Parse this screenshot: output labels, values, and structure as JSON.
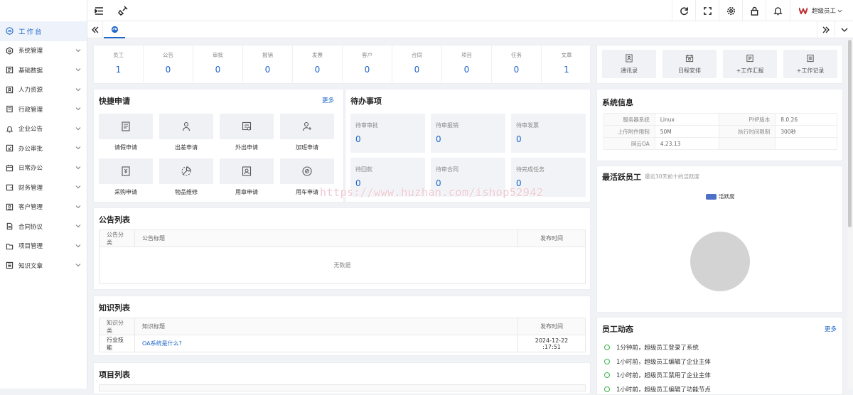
{
  "sidebar": {
    "items": [
      {
        "label": "工作台",
        "icon": "dashboard-icon"
      },
      {
        "label": "系统管理",
        "icon": "system-icon"
      },
      {
        "label": "基础数据",
        "icon": "database-icon"
      },
      {
        "label": "人力资源",
        "icon": "person-card-icon"
      },
      {
        "label": "行政管理",
        "icon": "admin-icon"
      },
      {
        "label": "企业公告",
        "icon": "bell-icon"
      },
      {
        "label": "办公审批",
        "icon": "approval-icon"
      },
      {
        "label": "日常办公",
        "icon": "calendar-icon"
      },
      {
        "label": "财务管理",
        "icon": "wallet-icon"
      },
      {
        "label": "客户管理",
        "icon": "customer-icon"
      },
      {
        "label": "合同协议",
        "icon": "contract-icon"
      },
      {
        "label": "项目管理",
        "icon": "folder-icon"
      },
      {
        "label": "知识文章",
        "icon": "article-icon"
      }
    ]
  },
  "topbar": {
    "user": "超级员工"
  },
  "stats": [
    {
      "label": "员工",
      "value": "1"
    },
    {
      "label": "公告",
      "value": "0"
    },
    {
      "label": "审批",
      "value": "0"
    },
    {
      "label": "报销",
      "value": "0"
    },
    {
      "label": "发票",
      "value": "0"
    },
    {
      "label": "客户",
      "value": "0"
    },
    {
      "label": "合同",
      "value": "0"
    },
    {
      "label": "项目",
      "value": "0"
    },
    {
      "label": "任务",
      "value": "0"
    },
    {
      "label": "文章",
      "value": "1"
    }
  ],
  "quick_links": [
    {
      "label": "通讯录"
    },
    {
      "label": "日程安排"
    },
    {
      "label": "+工作汇报"
    },
    {
      "label": "+工作记录"
    }
  ],
  "quick_apply": {
    "title": "快捷申请",
    "more": "更多",
    "items": [
      {
        "label": "请假申请"
      },
      {
        "label": "出差申请"
      },
      {
        "label": "外出申请"
      },
      {
        "label": "加班申请"
      },
      {
        "label": "采购申请"
      },
      {
        "label": "物品维修"
      },
      {
        "label": "用章申请"
      },
      {
        "label": "用车申请"
      }
    ]
  },
  "todo": {
    "title": "待办事项",
    "items": [
      {
        "label": "待审审批",
        "value": "0"
      },
      {
        "label": "待审报销",
        "value": "0"
      },
      {
        "label": "待审发票",
        "value": "0"
      },
      {
        "label": "待回款",
        "value": "0"
      },
      {
        "label": "待审合同",
        "value": "0"
      },
      {
        "label": "待完成任务",
        "value": "0"
      }
    ]
  },
  "sysinfo": {
    "title": "系统信息",
    "rows": [
      [
        "服务器系统",
        "Linux",
        "PHP版本",
        "8.0.26"
      ],
      [
        "上传附件限制",
        "50M",
        "执行时间限制",
        "300秒"
      ],
      [
        "网云OA",
        "4.23.13",
        "",
        ""
      ]
    ]
  },
  "active": {
    "title": "最活跃员工",
    "subtitle": "最近30天前十的活跃度",
    "legend": "活跃度"
  },
  "notice": {
    "title": "公告列表",
    "cols": [
      "公告分类",
      "公告标题",
      "发布时间"
    ],
    "empty": "无数据"
  },
  "knowledge": {
    "title": "知识列表",
    "cols": [
      "知识分类",
      "知识标题",
      "发布时间"
    ],
    "rows": [
      [
        "行业技能",
        "OA系统是什么?",
        "2024-12-22 :17:51"
      ]
    ]
  },
  "project": {
    "title": "项目列表"
  },
  "activity": {
    "title": "员工动态",
    "more": "更多",
    "items": [
      "1分钟前，超级员工登录了系统",
      "1小时前，超级员工编辑了企业主体",
      "1小时前，超级员工禁用了企业主体",
      "1小时前，超级员工编辑了功能节点"
    ]
  },
  "watermark": "https://www.huzhan.com/ishop52942",
  "colors": {
    "accent": "#1e66c8",
    "legend": "#4e6fc8",
    "pie": "#d3d3d3",
    "logo": "#c0282d"
  }
}
